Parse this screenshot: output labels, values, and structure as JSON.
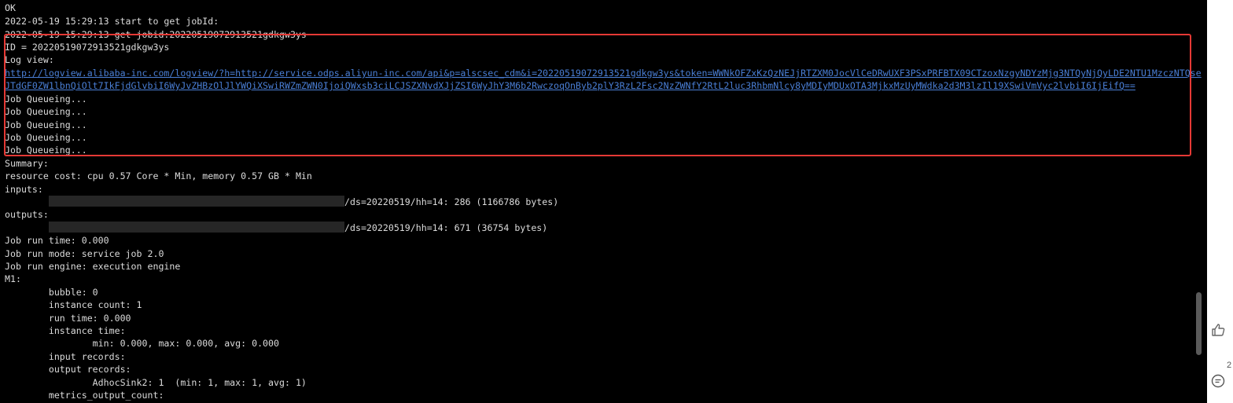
{
  "terminal": {
    "lines": [
      {
        "text": "OK"
      },
      {
        "text": "2022-05-19 15:29:13 start to get jobId:"
      },
      {
        "text": "2022-05-19 15:29:13 get jobid:20220519072913521gdkgw3ys"
      },
      {
        "text": "ID = 20220519072913521gdkgw3ys"
      },
      {
        "text": "Log view:"
      },
      {
        "text": "http://logview.alibaba-inc.com/logview/?h=http://service.odps.aliyun-inc.com/api&p=alscsec_cdm&i=20220519072913521gdkgw3ys&token=WWNkOFZxKzQzNEJjRTZXM0JocVlCeDRwUXF3PSxPRFBTX09CTzoxNzgyNDYzMjg3NTQyNjQyLDE2NTU1MzczNTQse"
      },
      {
        "text": "JTdGF0ZW1lbnQiOlt7IkFjdGlvbiI6WyJvZHBzOlJlYWQiXSwiRWZmZWN0IjoiQWxsb3ciLCJSZXNvdXJjZSI6WyJhY3M6b2RwczoqOnByb2plY3RzL2Fsc2NzZWNfY2RtL2luc3RhbmNlcy8yMDIyMDUxOTA3MjkxMzUyMWdka2d3M3lzIl19XSwiVmVyc2lvbiI6IjEifQ=="
      },
      {
        "text": "Job Queueing..."
      },
      {
        "text": "Job Queueing..."
      },
      {
        "text": "Job Queueing..."
      },
      {
        "text": "Job Queueing..."
      },
      {
        "text": "Job Queueing..."
      },
      {
        "text": "Summary:"
      },
      {
        "text": "resource cost: cpu 0.57 Core * Min, memory 0.57 GB * Min"
      },
      {
        "text": "inputs:"
      },
      {
        "text": "/ds=20220519/hh=14: 286 (1166786 bytes)"
      },
      {
        "text": "outputs:"
      },
      {
        "text": "/ds=20220519/hh=14: 671 (36754 bytes)"
      },
      {
        "text": ""
      },
      {
        "text": "Job run time: 0.000"
      },
      {
        "text": "Job run mode: service job 2.0"
      },
      {
        "text": "Job run engine: execution engine"
      },
      {
        "text": "M1:"
      },
      {
        "text": "        bubble: 0"
      },
      {
        "text": "        instance count: 1"
      },
      {
        "text": "        run time: 0.000"
      },
      {
        "text": "        instance time:"
      },
      {
        "text": "                min: 0.000, max: 0.000, avg: 0.000"
      },
      {
        "text": "        input records:"
      },
      {
        "text": "        output records:"
      },
      {
        "text": "                AdhocSink2: 1  (min: 1, max: 1, avg: 1)"
      },
      {
        "text": "        metrics_output_count:"
      }
    ]
  },
  "sidebar": {
    "comment_count": "2"
  },
  "colors": {
    "background": "#000000",
    "text": "#dcdcdc",
    "link": "#4a7fd6",
    "highlight_border": "#e53935"
  }
}
